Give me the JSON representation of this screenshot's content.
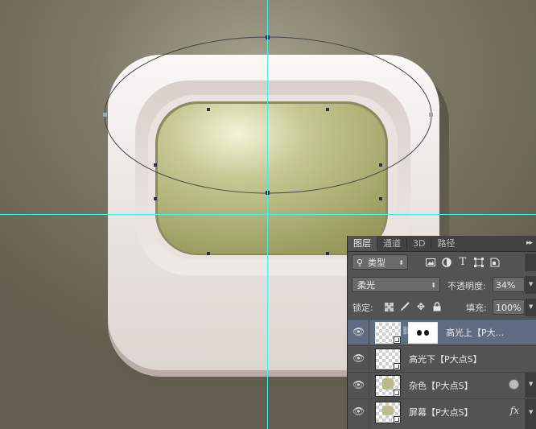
{
  "layers_panel": {
    "tabs": [
      "图层",
      "通道",
      "3D",
      "路径"
    ],
    "active_tab": 0,
    "menu_glyph": "▸▸",
    "filter": {
      "label": "类型",
      "icon": "search-icon"
    },
    "filter_icons": [
      "image-filter-icon",
      "adjustment-filter-icon",
      "type-filter-icon",
      "shape-filter-icon",
      "smart-object-filter-icon"
    ],
    "blend_mode": "柔光",
    "opacity_label": "不透明度:",
    "opacity_value": "34%",
    "lock_label": "锁定:",
    "fill_label": "填充:",
    "fill_value": "100%",
    "layers": [
      {
        "name": "高光上【P大...",
        "selected": true,
        "has_mask": true
      },
      {
        "name": "高光下【P大点S】",
        "selected": false
      },
      {
        "name": "杂色【P大点S】",
        "selected": false
      },
      {
        "name": "屏幕【P大点S】",
        "selected": false,
        "fx": "fx"
      }
    ]
  },
  "colors": {
    "panel_bg": "#535353",
    "selected_layer": "#5f6c82",
    "guide_color": "#3ff0f0",
    "screen_green": "#b9bb82",
    "icon_body": "#ece6e2"
  }
}
